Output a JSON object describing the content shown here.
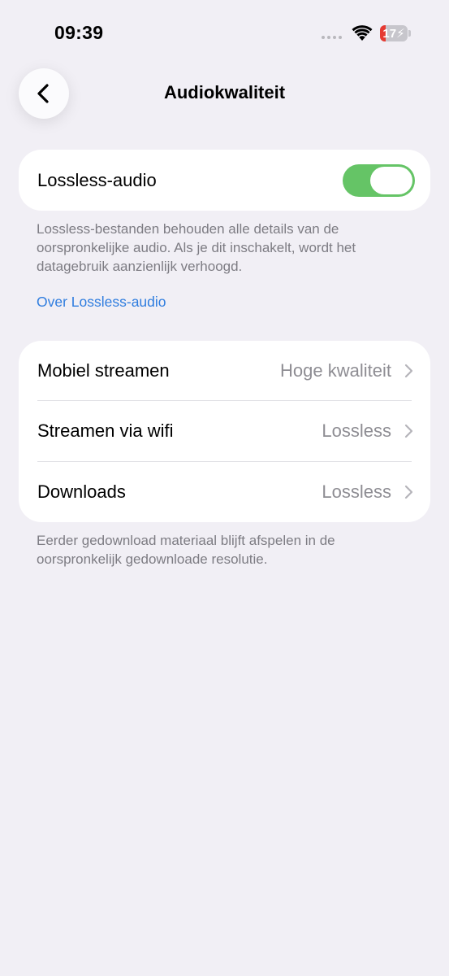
{
  "status_bar": {
    "time": "09:39",
    "battery_level": "17",
    "battery_color": "#e63a32"
  },
  "nav": {
    "title": "Audiokwaliteit",
    "back_icon": "chevron-left-icon"
  },
  "lossless": {
    "label": "Lossless-audio",
    "enabled": true,
    "toggle_color": "#65c466",
    "description": "Lossless-bestanden behouden alle details van de oorspronkelijke audio. Als je dit inschakelt, wordt het datagebruik aanzienlijk verhoogd.",
    "link": "Over Lossless-audio",
    "link_color": "#2f7ddf"
  },
  "quality": {
    "rows": [
      {
        "label": "Mobiel streamen",
        "value": "Hoge kwaliteit"
      },
      {
        "label": "Streamen via wifi",
        "value": "Lossless"
      },
      {
        "label": "Downloads",
        "value": "Lossless"
      }
    ],
    "footnote": "Eerder gedownload materiaal blijft afspelen in de oorspronkelijk gedownloade resolutie."
  }
}
